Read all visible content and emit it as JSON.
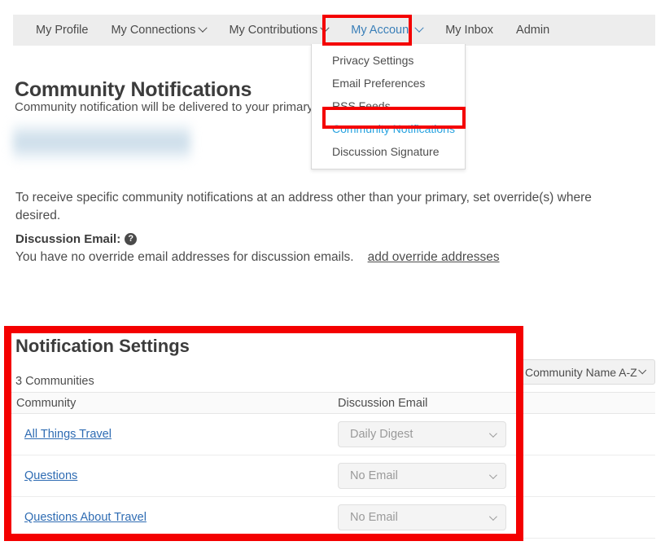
{
  "nav": {
    "items": [
      {
        "label": "My Profile",
        "has_caret": false,
        "active": false
      },
      {
        "label": "My Connections",
        "has_caret": true,
        "active": false
      },
      {
        "label": "My Contributions",
        "has_caret": true,
        "active": false
      },
      {
        "label": "My Account",
        "has_caret": true,
        "active": true
      },
      {
        "label": "My Inbox",
        "has_caret": false,
        "active": false
      },
      {
        "label": "Admin",
        "has_caret": false,
        "active": false
      }
    ]
  },
  "dropdown": {
    "items": [
      {
        "label": "Privacy Settings",
        "highlighted": false
      },
      {
        "label": "Email Preferences",
        "highlighted": false
      },
      {
        "label": "RSS Feeds",
        "highlighted": false
      },
      {
        "label": "Community Notifications",
        "highlighted": true
      },
      {
        "label": "Discussion Signature",
        "highlighted": false
      }
    ]
  },
  "page": {
    "title": "Community Notifications",
    "subtitle": "Community notification will be delivered to your primary email address:",
    "redacted_email_note": "",
    "paragraph": "To receive specific community notifications at an address other than your primary, set override(s) where desired.",
    "discussion_email_label": "Discussion Email:",
    "help_icon_glyph": "?",
    "override_status": "You have no override email addresses for discussion emails.",
    "override_link": "add override addresses"
  },
  "settings": {
    "title": "Notification Settings",
    "community_count": "3 Communities",
    "sort": {
      "selected": "Community Name A-Z"
    },
    "table": {
      "columns": [
        "Community",
        "Discussion Email"
      ],
      "rows": [
        {
          "community": "All Things Travel",
          "discussion_email": "Daily Digest"
        },
        {
          "community": "Questions",
          "discussion_email": "No Email"
        },
        {
          "community": "Questions About Travel",
          "discussion_email": "No Email"
        }
      ]
    }
  },
  "annotations": {
    "color": "#f40000",
    "boxes": [
      "my-account-nav",
      "community-notifications-menu-item",
      "notification-settings-panel"
    ]
  }
}
